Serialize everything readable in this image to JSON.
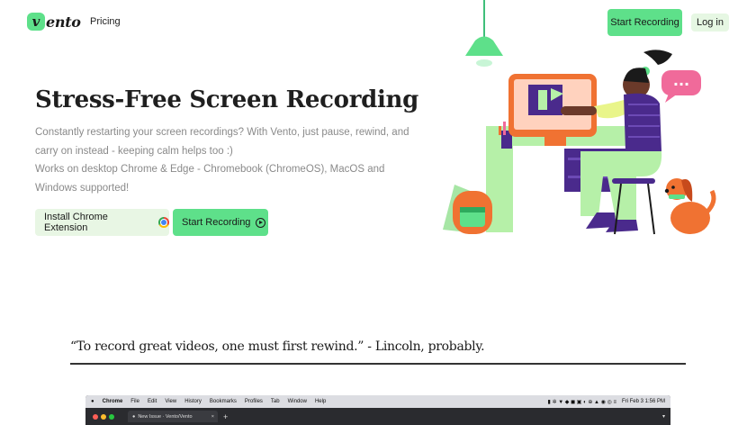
{
  "nav": {
    "logo_mark": "v",
    "logo_text": "ento",
    "pricing": "Pricing",
    "start_recording": "Start Recording",
    "login": "Log in"
  },
  "hero": {
    "title": "Stress-Free Screen Recording",
    "desc_line1": "Constantly restarting your screen recordings? With Vento, just pause, rewind, and carry on instead - keeping calm helps too :)",
    "desc_line2": "Works on desktop Chrome & Edge - Chromebook (ChromeOS), MacOS and Windows supported!",
    "install_button": "Install Chrome Extension",
    "record_button": "Start Recording",
    "speech_bubble": "..."
  },
  "quote": {
    "text": "“To record great videos, one must first rewind.” - Lincoln, probably."
  },
  "screenshot": {
    "menubar": [
      "Chrome",
      "File",
      "Edit",
      "View",
      "History",
      "Bookmarks",
      "Profiles",
      "Tab",
      "Window",
      "Help"
    ],
    "clock": "Fri Feb 3  1:56 PM",
    "tab_title": "New Issue · Vento/Vento",
    "tab_close": "×",
    "new_tab": "+"
  },
  "colors": {
    "accent_green": "#5ee08a",
    "light_green": "#e8f6e4",
    "illustration_orange": "#f07232",
    "illustration_purple": "#4a2a8c",
    "bubble_pink": "#f06a9a"
  }
}
